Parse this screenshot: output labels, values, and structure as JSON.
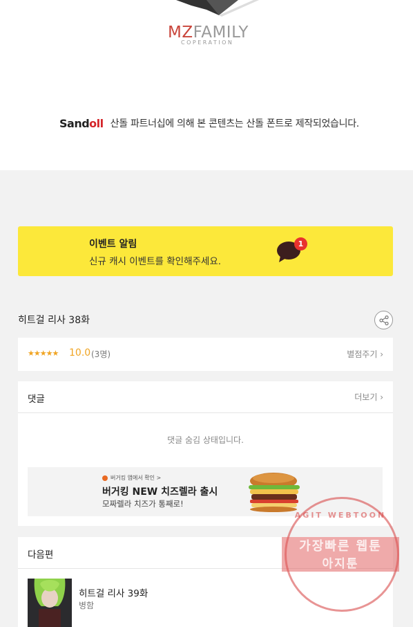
{
  "brand": {
    "logo_primary_mz": "MZ",
    "logo_primary_rest": "FAMILY",
    "logo_sub": "COPERATION"
  },
  "notice": {
    "sandoll_logo_a": "Sand",
    "sandoll_logo_b": "oll",
    "text": "산돌 파트너십에 의해 본 콘텐츠는 산돌 폰트로 제작되었습니다."
  },
  "event": {
    "title": "이벤트 알림",
    "description": "신규 캐시 이벤트를 확인해주세요.",
    "badge_count": "1",
    "bg_color": "#fce83a"
  },
  "episode": {
    "title": "히트걸 리사 38화",
    "share_icon": "share-icon"
  },
  "rating": {
    "stars": "★★★★★",
    "score": "10.0",
    "count": "(3명)",
    "rate_link": "별점주기 ›"
  },
  "comments": {
    "header": "댓글",
    "more_link": "더보기 ›",
    "status": "댓글 숨김 상태입니다."
  },
  "ad": {
    "small": "버거킹 앱에서 확인 >",
    "title": "버거킹 NEW 치즈렐라 출시",
    "subtitle": "모짜렐라 치즈가 통째로!"
  },
  "next": {
    "header": "다음편",
    "title": "히트걸 리사 39화",
    "subtitle": "병함"
  },
  "watermark": {
    "ring_text": "AGIT WEBTOON",
    "line1": "가장빠른 웹툰",
    "line2": "아지툰"
  }
}
